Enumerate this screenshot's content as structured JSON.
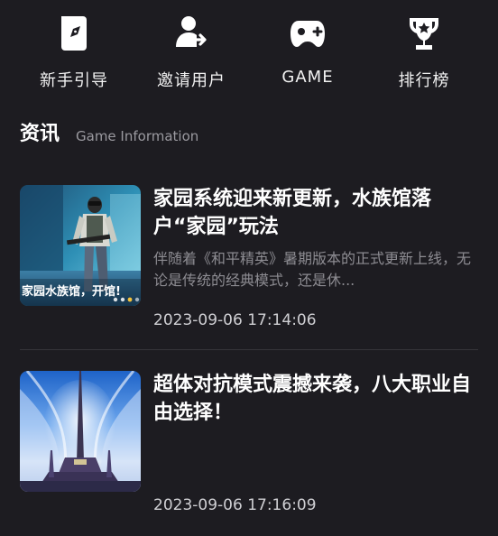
{
  "nav": {
    "items": [
      {
        "label": "新手引导",
        "icon": "guide-book-icon"
      },
      {
        "label": "邀请用户",
        "icon": "invite-user-icon"
      },
      {
        "label": "GAME",
        "icon": "gamepad-icon"
      },
      {
        "label": "排行榜",
        "icon": "trophy-icon"
      }
    ]
  },
  "section": {
    "title": "资讯",
    "subtitle": "Game Information"
  },
  "articles": [
    {
      "title": "家园系统迎来新更新，水族馆落户“家园”玩法",
      "excerpt": "伴随着《和平精英》暑期版本的正式更新上线，无论是传统的经典模式，还是休...",
      "date": "2023-09-06 17:14:06",
      "image_caption": "家园水族馆，开馆!"
    },
    {
      "title": "超体对抗模式震撼来袭，八大职业自由选择！",
      "date": "2023-09-06 17:16:09"
    }
  ],
  "colors": {
    "background": "#1d1c21",
    "text": "#ffffff",
    "muted": "#8d8c92"
  }
}
